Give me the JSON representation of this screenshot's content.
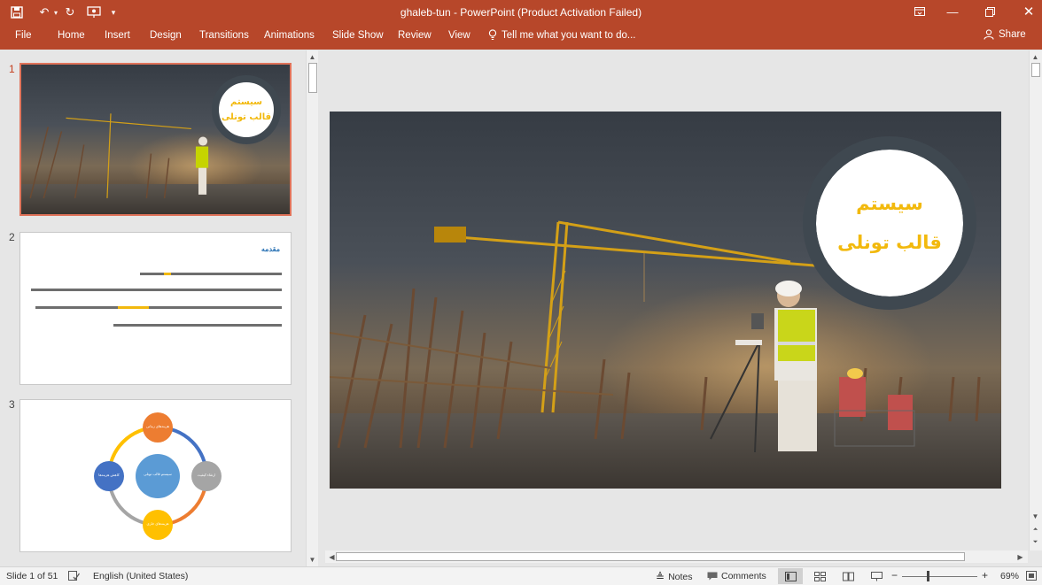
{
  "title_bar": {
    "title": "ghaleb-tun - PowerPoint (Product Activation Failed)",
    "qa_icons": [
      "save-icon",
      "undo-icon",
      "redo-icon",
      "present-from-beginning-icon",
      "customize-qa-icon"
    ],
    "controls": [
      "ribbon-display-icon",
      "minimize-icon",
      "restore-icon",
      "close-icon"
    ]
  },
  "ribbon": {
    "tabs": [
      "File",
      "Home",
      "Insert",
      "Design",
      "Transitions",
      "Animations",
      "Slide Show",
      "Review",
      "View"
    ],
    "tell_me": "Tell me what you want to do...",
    "share": "Share"
  },
  "thumbnails": [
    {
      "number": "1",
      "active": true
    },
    {
      "number": "2",
      "active": false
    },
    {
      "number": "3",
      "active": false
    }
  ],
  "slide1": {
    "badge_line1": "سیستم",
    "badge_line2": "قالب تونلی",
    "accent": "#f2b90d",
    "ring": "#3f4850"
  },
  "slide2": {
    "title": "مقدمه"
  },
  "slide3": {
    "center": "سیستم قالب تونلی",
    "nodes": [
      {
        "label": "هزینه‌های زمانی",
        "color": "#ed7d31"
      },
      {
        "label": "ارتقاء کیفیت",
        "color": "#a5a5a5"
      },
      {
        "label": "هزینه‌های جاری",
        "color": "#ffc000"
      },
      {
        "label": "کاهش هزینه‌ها",
        "color": "#4472c4"
      }
    ],
    "center_color": "#5b9bd5"
  },
  "status_bar": {
    "slide_info": "Slide 1 of 51",
    "language": "English (United States)",
    "notes": "Notes",
    "comments": "Comments",
    "zoom": "69%"
  }
}
